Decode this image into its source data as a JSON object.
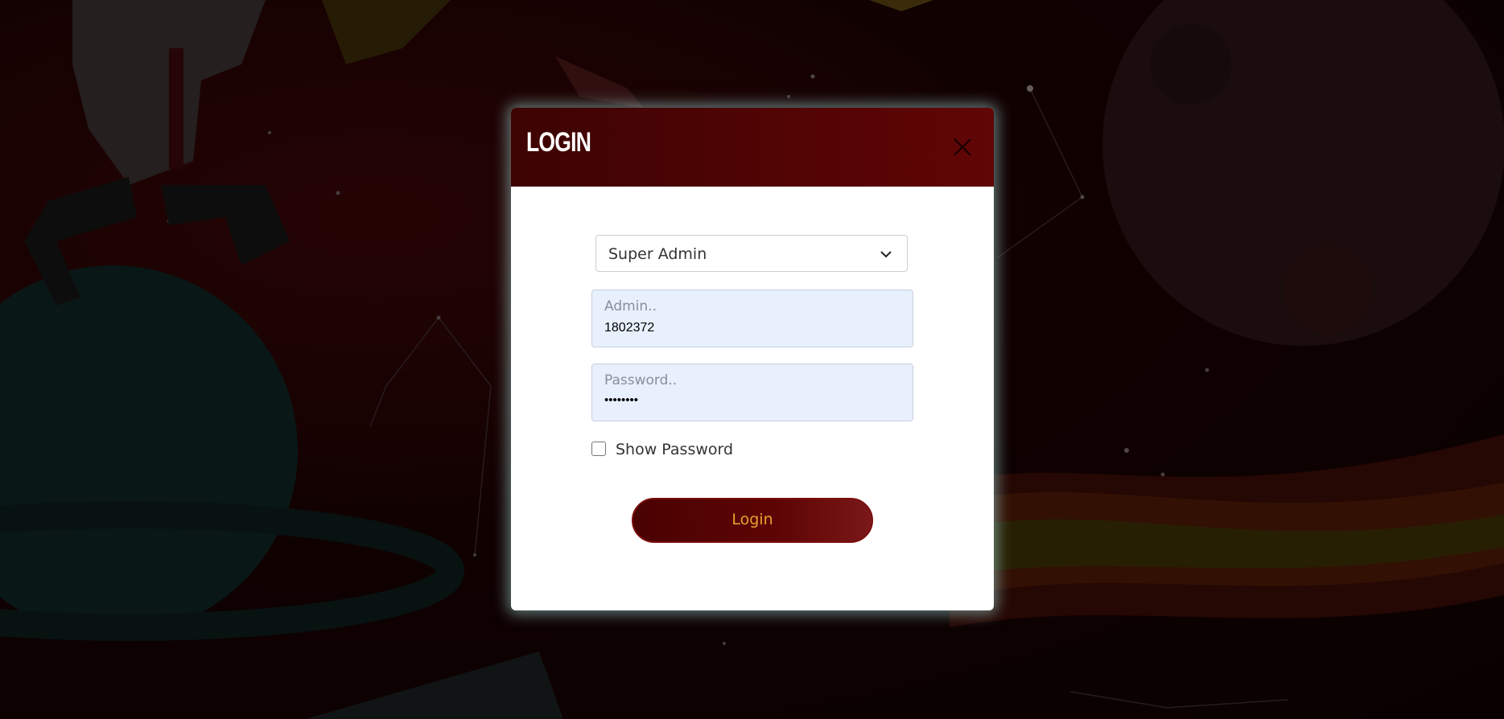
{
  "modal": {
    "title": "Login",
    "close_icon": "close-icon"
  },
  "role_select": {
    "selected": "Super Admin",
    "icon": "chevron-down-icon"
  },
  "admin_field": {
    "label": "Admin..",
    "value": "1802372"
  },
  "password_field": {
    "label": "Password..",
    "value": "••••••••"
  },
  "show_password": {
    "label": "Show Password",
    "checked": false
  },
  "login_button": {
    "label": "Login"
  },
  "colors": {
    "header_dark": "#3d0303",
    "header_light": "#610505",
    "button_text": "#e6a330",
    "field_bg": "#e8f0fe"
  }
}
